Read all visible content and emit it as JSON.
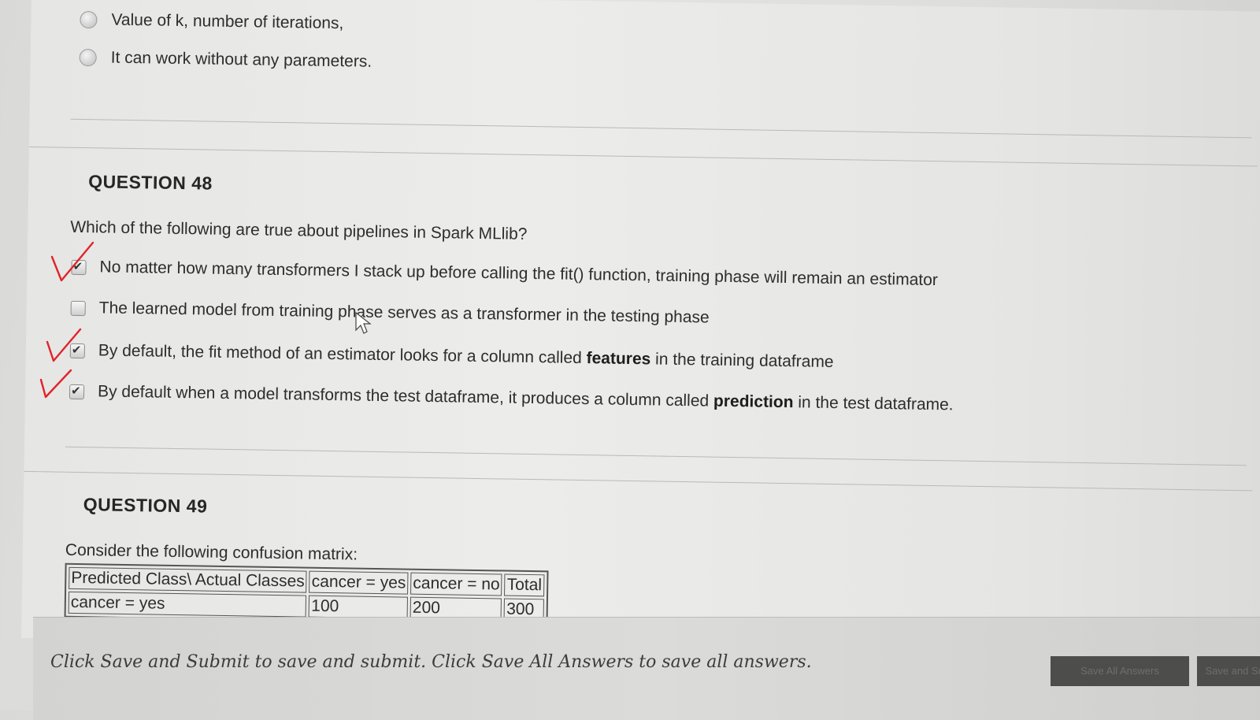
{
  "prev_question": {
    "options": [
      "Value of k, number of iterations,",
      "It can  work without any parameters."
    ]
  },
  "q48": {
    "title": "QUESTION 48",
    "text": "Which of the following are true about pipelines in Spark MLlib?",
    "options": [
      {
        "text": "No matter how many transformers I stack up before calling the fit() function, training phase will remain an estimator",
        "checked": true
      },
      {
        "text": "The learned model from training phase serves as a transformer in the testing phase",
        "checked": false
      },
      {
        "text_before": "By default, the fit method of an estimator looks for a column called ",
        "bold": "features",
        "text_after": " in the training dataframe",
        "checked": true
      },
      {
        "text_before": "By default when a model transforms the test dataframe, it produces a column called ",
        "bold": "prediction",
        "text_after": " in the test dataframe.",
        "checked": true
      }
    ]
  },
  "q49": {
    "title": "QUESTION 49",
    "text": "Consider the following confusion matrix:",
    "table": {
      "headers": [
        "Predicted Class\\ Actual Classes",
        "cancer = yes",
        "cancer = no",
        "Total"
      ],
      "rows": [
        [
          "cancer = yes",
          "100",
          "200",
          "300"
        ]
      ]
    }
  },
  "footer": {
    "instruction": "Click Save and Submit to save and submit. Click Save All Answers to save all answers.",
    "save_all_label": "Save All Answers",
    "save_submit_label": "Save and Submit"
  },
  "colors": {
    "check_mark": "#e0242a",
    "button_bg": "#4d4d4b"
  }
}
